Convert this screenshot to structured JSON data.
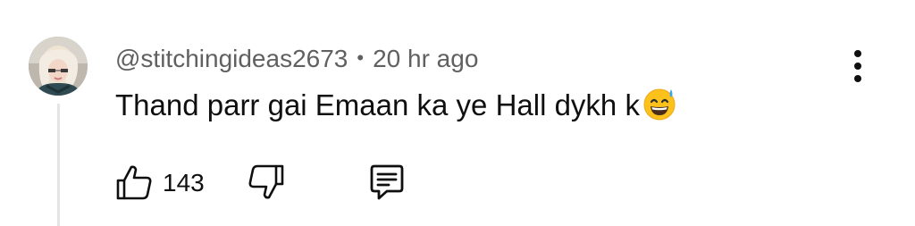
{
  "comment": {
    "author": "@stitchingideas2673",
    "separator": "•",
    "timestamp": "20 hr ago",
    "text": "Thand parr gai Emaan ka ye Hall dykh k",
    "emoji": "grinning-face-with-sweat",
    "like_count": "143"
  },
  "icons": {
    "avatar": "user-avatar",
    "more": "more-vert-icon",
    "like": "thumbs-up-icon",
    "dislike": "thumbs-down-icon",
    "reply": "comment-reply-icon"
  },
  "colors": {
    "text_primary": "#0f0f0f",
    "text_secondary": "#606060",
    "thread_line": "#e5e5e5",
    "background": "#ffffff"
  }
}
